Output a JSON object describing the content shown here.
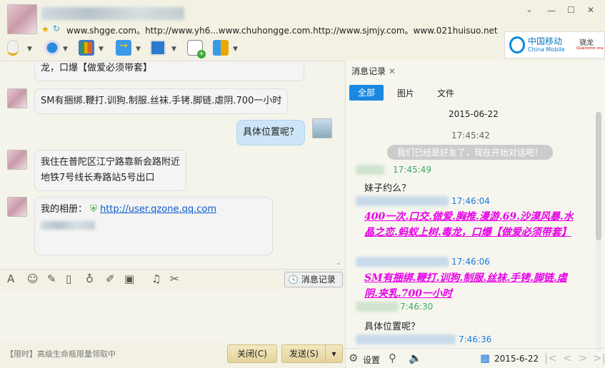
{
  "header": {
    "status_text": "www.shgge.com。http://www.yh6...www.chuhongge.com.http://www.sjmjy.com。www.021huisuo.net",
    "ad_brand": "中国移动",
    "ad_brand_en": "China Mobile",
    "ad_chip": "骁龙",
    "ad_chip_en": "Qualcomm snapdragon"
  },
  "window_controls": {
    "minimize": "—",
    "maximize": "☐",
    "close": "✕",
    "menu": "⌄"
  },
  "chat": {
    "messages": [
      {
        "from": "other",
        "text": "龙，口爆【做爱必须带套】"
      },
      {
        "from": "other",
        "text": "SM有捆绑.鞭打.训狗.制服.丝袜.手铐.脚链.虐阴.700一小时"
      },
      {
        "from": "me",
        "text": "具体位置呢？"
      },
      {
        "from": "other",
        "text": "我住在普陀区江宁路靠新会路附近\n地铁7号线长寿路站5号出口"
      },
      {
        "from": "other",
        "label": "我的相册：",
        "link": "http://user.qzone.qq.com"
      }
    ]
  },
  "input_toolbar": {
    "history_button": "消息记录"
  },
  "footer": {
    "promo": "【限时】高级生命瓶限量领取中",
    "close_button": "关闭(C)",
    "send_button": "发送(S)"
  },
  "history": {
    "tab_title": "消息记录",
    "filters": [
      "全部",
      "图片",
      "文件"
    ],
    "date": "2015-06-22",
    "system_time": "17:45:42",
    "system_msg": "我们已经是好友了，现在开始对话吧！",
    "entries": [
      {
        "time": "17:45:49",
        "side": "other",
        "text": "妹子约么？"
      },
      {
        "time": "17:46:04",
        "side": "me",
        "text": "400一次.口交.做爱.胸推.漫游.69.沙漠风暴.水晶之恋.蚂蚁上树.毒龙，口爆【做爱必须带套】"
      },
      {
        "time": "17:46:06",
        "side": "me",
        "text": "SM有捆绑.鞭打.训狗.制服.丝袜.手铐.脚链.虐阴.夹乳.700一小时"
      },
      {
        "time": "7:46:30",
        "side": "other",
        "text": "具体位置呢？"
      },
      {
        "time": "7:46:36",
        "side": "me",
        "text": ""
      }
    ],
    "settings": "设置",
    "date_picker": "2015-6-22"
  }
}
